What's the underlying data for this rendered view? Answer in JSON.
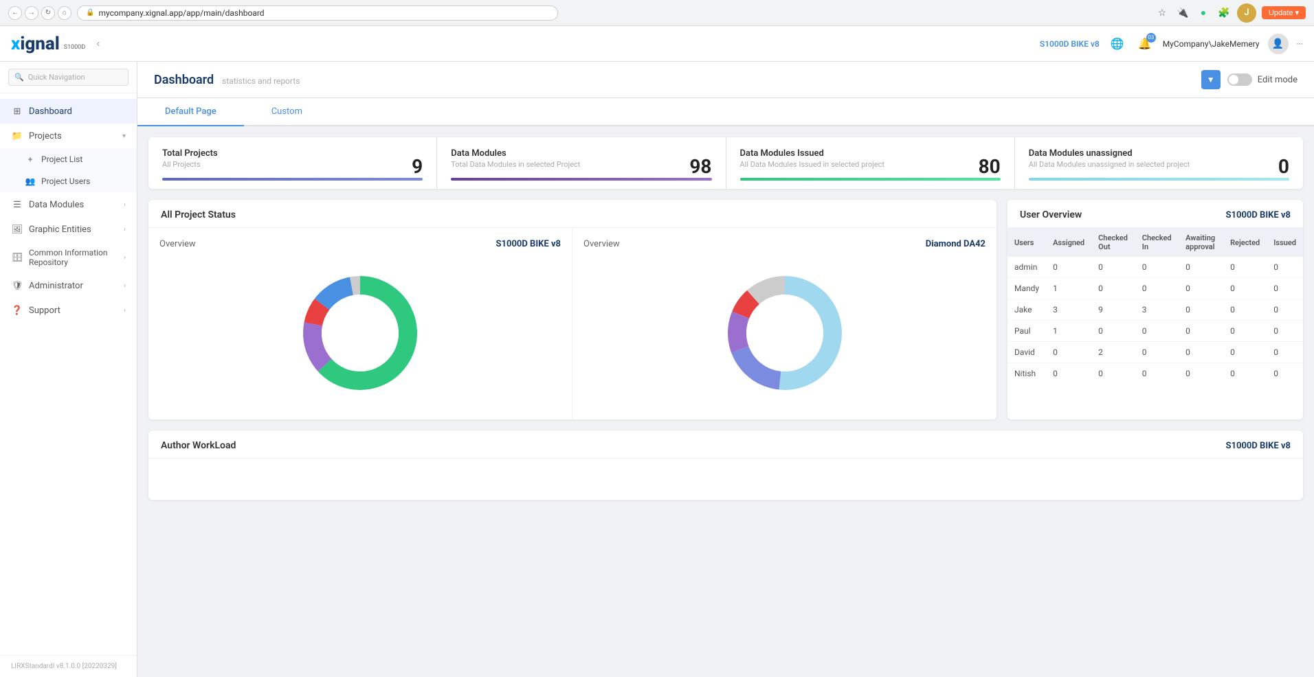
{
  "browser": {
    "url": "mycompany.xignal.app/app/main/dashboard",
    "update_label": "Update"
  },
  "header": {
    "logo_main": "xignal",
    "logo_sub": "S1000D",
    "project_badge": "S1000D BIKE v8",
    "user_name": "MyCompany\\JakeMemery",
    "notification_count": "03",
    "update_label": "Update"
  },
  "sidebar": {
    "search_placeholder": "Quick Navigation",
    "nav_items": [
      {
        "id": "dashboard",
        "label": "Dashboard",
        "icon": "dashboard",
        "active": true
      },
      {
        "id": "projects",
        "label": "Projects",
        "icon": "projects",
        "has_children": true,
        "expanded": true
      },
      {
        "id": "project-list",
        "label": "Project List",
        "icon": "plus",
        "is_sub": true
      },
      {
        "id": "project-users",
        "label": "Project Users",
        "icon": "users",
        "is_sub": true
      },
      {
        "id": "data-modules",
        "label": "Data Modules",
        "icon": "layers",
        "has_children": true
      },
      {
        "id": "graphic-entities",
        "label": "Graphic Entities",
        "icon": "image",
        "has_children": true
      },
      {
        "id": "common-info",
        "label": "Common Information Repository",
        "icon": "database",
        "has_children": true
      },
      {
        "id": "administrator",
        "label": "Administrator",
        "icon": "shield",
        "has_children": true
      },
      {
        "id": "support",
        "label": "Support",
        "icon": "help",
        "has_children": true
      }
    ],
    "footer_text": "LIRXStandardI v8.1.0.0 [20220329]"
  },
  "main": {
    "title": "Dashboard",
    "subtitle": "statistics and reports",
    "tabs": [
      {
        "id": "default",
        "label": "Default Page",
        "active": true
      },
      {
        "id": "custom",
        "label": "Custom",
        "active": false
      }
    ],
    "edit_mode_label": "Edit mode"
  },
  "stats": [
    {
      "label": "Total Projects",
      "desc": "All Projects",
      "value": "9",
      "bar_color": "bar-blue"
    },
    {
      "label": "Data Modules",
      "desc": "Total Data Modules in selected Project",
      "value": "98",
      "bar_color": "bar-purple"
    },
    {
      "label": "Data Modules Issued",
      "desc": "All Data Modules Issued in selected project",
      "value": "80",
      "bar_color": "bar-green"
    },
    {
      "label": "Data Modules unassigned",
      "desc": "All Data Modules unassigned in selected project",
      "value": "0",
      "bar_color": "bar-cyan"
    }
  ],
  "project_status": {
    "title": "All Project Status",
    "charts": [
      {
        "overview_label": "Overview",
        "project_name": "S1000D BIKE v8",
        "segments": [
          {
            "color": "#2ec97e",
            "pct": 68
          },
          {
            "color": "#9b6fd0",
            "pct": 10
          },
          {
            "color": "#e84040",
            "pct": 5
          },
          {
            "color": "#4a90e2",
            "pct": 8
          },
          {
            "color": "#ccc",
            "pct": 9
          }
        ]
      },
      {
        "overview_label": "Overview",
        "project_name": "Diamond DA42",
        "segments": [
          {
            "color": "#a0d8ef",
            "pct": 60
          },
          {
            "color": "#7b8ce0",
            "pct": 12
          },
          {
            "color": "#9b6fd0",
            "pct": 8
          },
          {
            "color": "#e84040",
            "pct": 5
          },
          {
            "color": "#ccc",
            "pct": 15
          }
        ]
      }
    ]
  },
  "user_overview": {
    "title": "User Overview",
    "project": "S1000D BIKE v8",
    "columns": [
      "Users",
      "Assigned",
      "Checked Out",
      "Checked In",
      "Awaiting approval",
      "Rejected",
      "Issued"
    ],
    "rows": [
      {
        "user": "admin",
        "assigned": 0,
        "checked_out": 0,
        "checked_in": 0,
        "awaiting": 0,
        "rejected": 0,
        "issued": 0
      },
      {
        "user": "Mandy",
        "assigned": 1,
        "checked_out": 0,
        "checked_in": 0,
        "awaiting": 0,
        "rejected": 0,
        "issued": 0
      },
      {
        "user": "Jake",
        "assigned": 3,
        "checked_out": 9,
        "checked_in": 3,
        "awaiting": 0,
        "rejected": 0,
        "issued": 0
      },
      {
        "user": "Paul",
        "assigned": 1,
        "checked_out": 0,
        "checked_in": 0,
        "awaiting": 0,
        "rejected": 0,
        "issued": 0
      },
      {
        "user": "David",
        "assigned": 0,
        "checked_out": 2,
        "checked_in": 0,
        "awaiting": 0,
        "rejected": 0,
        "issued": 0
      },
      {
        "user": "Nitish",
        "assigned": 0,
        "checked_out": 0,
        "checked_in": 0,
        "awaiting": 0,
        "rejected": 0,
        "issued": 0
      }
    ]
  },
  "author_workload": {
    "title": "Author WorkLoad",
    "project": "S1000D BIKE v8"
  }
}
